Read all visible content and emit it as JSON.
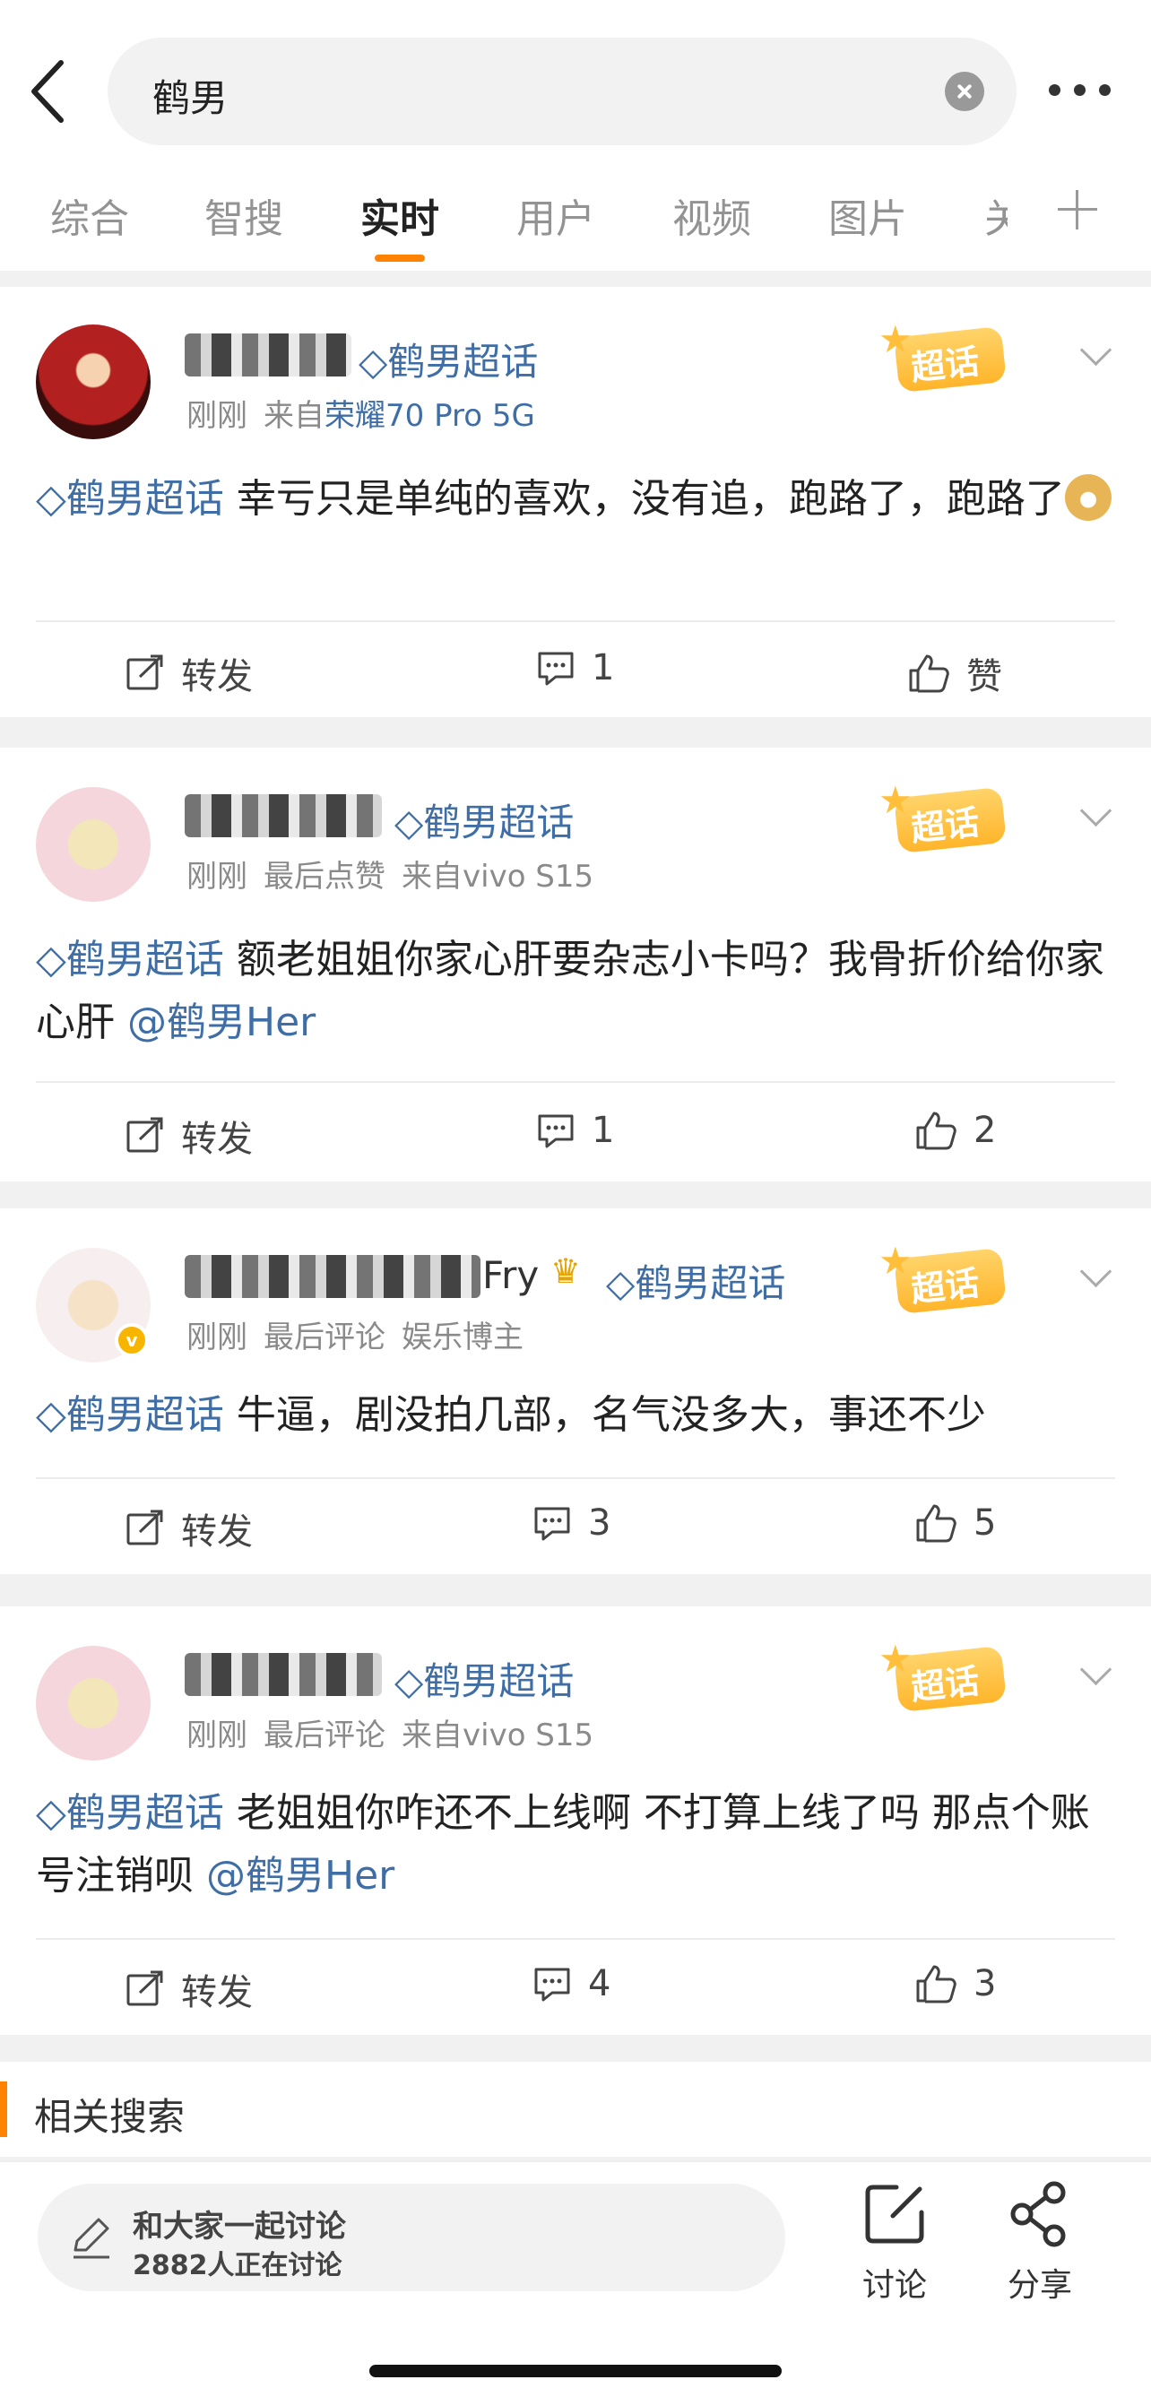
{
  "search": {
    "query": "鹤男"
  },
  "tabs": [
    "综合",
    "智搜",
    "实时",
    "用户",
    "视频",
    "图片",
    "关"
  ],
  "active_tab": "实时",
  "topic_tag": "鹤男超话",
  "super_badge": "超话",
  "posts": [
    {
      "name_tail": "",
      "meta": [
        "刚刚",
        "来自",
        "荣耀70 Pro 5G"
      ],
      "text_tag": "鹤男超话",
      "text": " 幸亏只是单纯的喜欢，没有追，跑路了，跑路了",
      "mention": "",
      "repost": "转发",
      "comments": "1",
      "likes": "赞"
    },
    {
      "name_tail": "",
      "meta": [
        "刚刚",
        "最后点赞",
        "来自vivo S15"
      ],
      "text_tag": "鹤男超话",
      "text": " 额老姐姐你家心肝要杂志小卡吗？我骨折价给你家心肝 ",
      "mention": "@鹤男Her",
      "repost": "转发",
      "comments": "1",
      "likes": "2"
    },
    {
      "name_tail": "Fry",
      "meta": [
        "刚刚",
        "最后评论",
        "娱乐博主"
      ],
      "text_tag": "鹤男超话",
      "text": " 牛逼，剧没拍几部，名气没多大，事还不少",
      "mention": "",
      "repost": "转发",
      "comments": "3",
      "likes": "5"
    },
    {
      "name_tail": "",
      "meta": [
        "刚刚",
        "最后评论",
        "来自vivo S15"
      ],
      "text_tag": "鹤男超话",
      "text": " 老姐姐你咋还不上线啊 不打算上线了吗 那点个账号注销呗 ",
      "mention": "@鹤男Her",
      "repost": "转发",
      "comments": "4",
      "likes": "3"
    }
  ],
  "related": {
    "title": "相关搜索"
  },
  "bottom": {
    "discuss_title": "和大家一起讨论",
    "discuss_sub": "2882人正在讨论",
    "discuss_btn": "讨论",
    "share_btn": "分享"
  },
  "colors": {
    "accent": "#ff8200",
    "link": "#3f6ea6",
    "badge": "#ffb52b"
  }
}
